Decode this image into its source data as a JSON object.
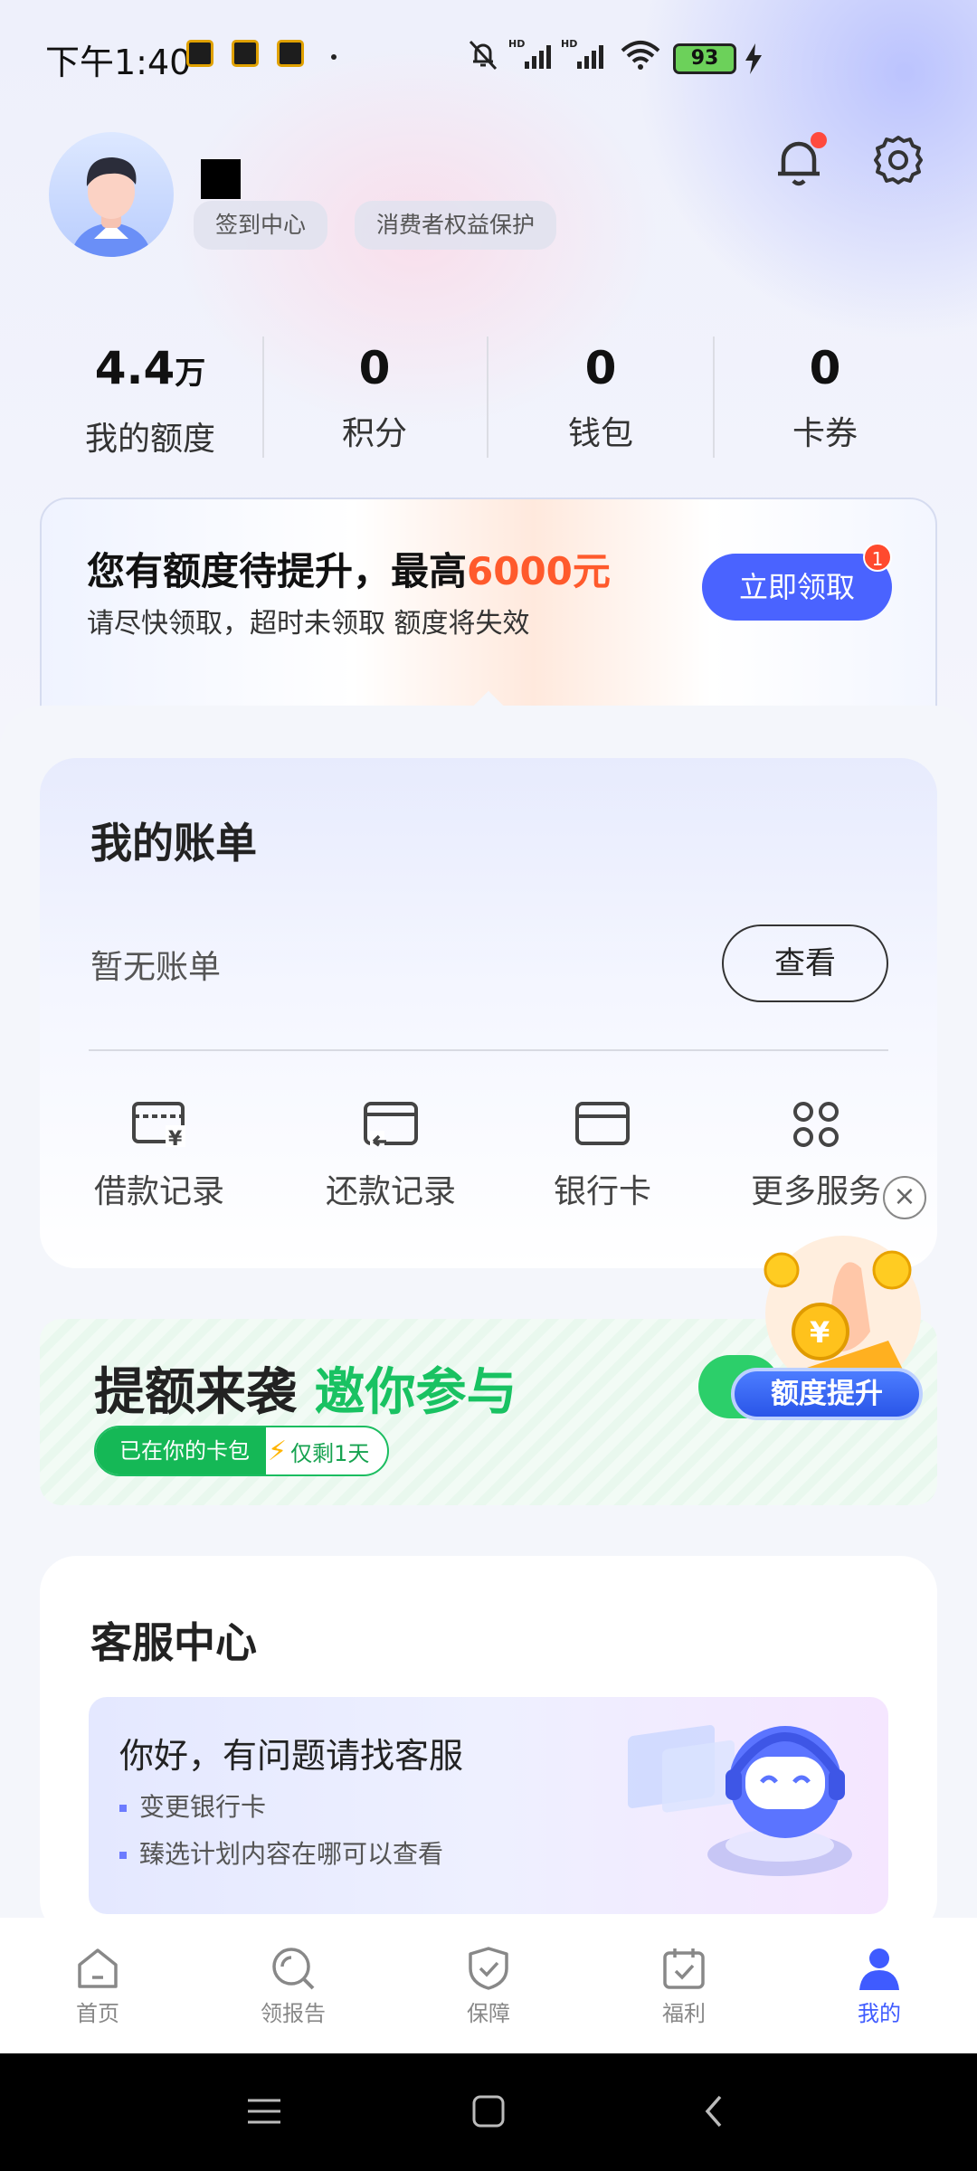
{
  "status_bar": {
    "time": "下午1:40",
    "battery": "93",
    "icons": [
      "notification-muted-icon",
      "signal-hd-icon",
      "signal-hd-icon",
      "wifi-icon",
      "battery-icon",
      "charging-icon"
    ]
  },
  "profile": {
    "chips": [
      "签到中心",
      "消费者权益保护"
    ]
  },
  "stats": [
    {
      "value": "4.4",
      "unit": "万",
      "label": "我的额度"
    },
    {
      "value": "0",
      "unit": "",
      "label": "积分"
    },
    {
      "value": "0",
      "unit": "",
      "label": "钱包"
    },
    {
      "value": "0",
      "unit": "",
      "label": "卡券"
    }
  ],
  "promo": {
    "title_prefix": "您有额度待提升，最高",
    "title_highlight": "6000元",
    "subtitle": "请尽快领取，超时未领取 额度将失效",
    "button": "立即领取",
    "badge": "1",
    "highlight_color": "#ff5a2c",
    "button_color": "#4a63ff"
  },
  "bill": {
    "title": "我的账单",
    "empty_text": "暂无账单",
    "view_button": "查看",
    "services": [
      {
        "label": "借款记录",
        "icon": "loan-record-icon"
      },
      {
        "label": "还款记录",
        "icon": "repay-record-icon"
      },
      {
        "label": "银行卡",
        "icon": "bank-card-icon"
      },
      {
        "label": "更多服务",
        "icon": "more-services-icon"
      }
    ]
  },
  "banner": {
    "title_black": "提额来袭",
    "title_green": "邀你参与",
    "pill_left": "已在你的卡包",
    "pill_right": "仅剩1天",
    "button": "额度提升",
    "accent": "#19c262"
  },
  "customer_service": {
    "title": "客服中心",
    "greeting": "你好，有问题请找客服",
    "items": [
      "变更银行卡",
      "臻选计划内容在哪可以查看"
    ]
  },
  "tabs": [
    {
      "label": "首页",
      "icon": "home-icon"
    },
    {
      "label": "领报告",
      "icon": "report-search-icon"
    },
    {
      "label": "保障",
      "icon": "shield-check-icon"
    },
    {
      "label": "福利",
      "icon": "calendar-check-icon"
    },
    {
      "label": "我的",
      "icon": "person-icon",
      "active": true
    }
  ]
}
